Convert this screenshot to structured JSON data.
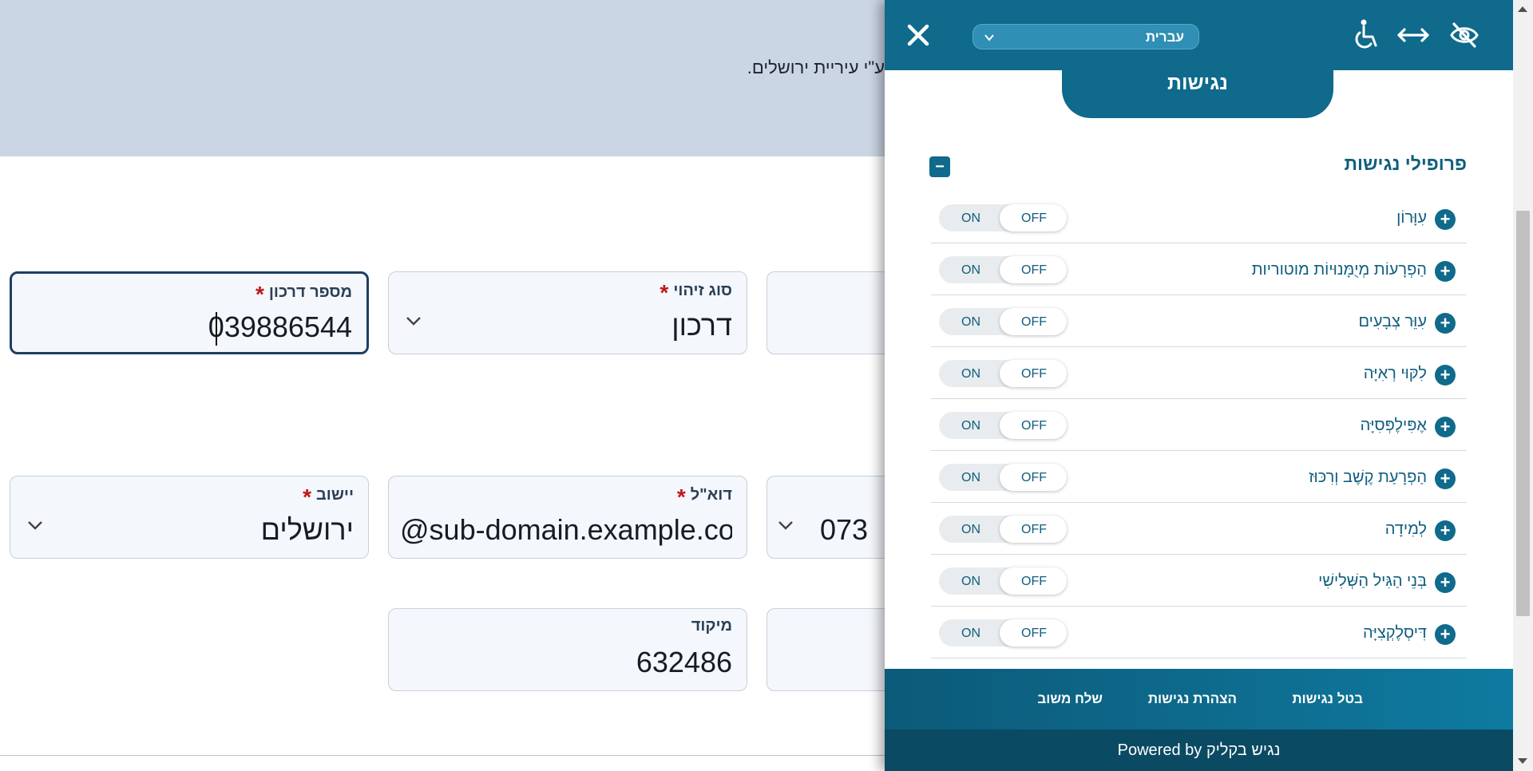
{
  "page": {
    "banner_text": "ע\"י עיריית ירושלים.",
    "fields": {
      "license_number": {
        "label": "מספר דרכון",
        "value": "039886544"
      },
      "id_type": {
        "label": "סוג זיהוי",
        "value": "דרכון"
      },
      "settlement": {
        "label": "יישוב",
        "value": "ירושלים"
      },
      "email": {
        "label": "דוא\"ל",
        "value": "@sub-domain.example.com"
      },
      "phone_prefix": {
        "value": "073"
      },
      "zip": {
        "label": "מיקוד",
        "value": "632486"
      }
    }
  },
  "accessibility": {
    "language": "עברית",
    "tab_title": "נגישות",
    "section_title": "פרופילי נגישות",
    "collapse_symbol": "−",
    "toggle_on": "ON",
    "toggle_off": "OFF",
    "profiles": [
      {
        "label": "עִוָּרוֹן",
        "state": "OFF"
      },
      {
        "label": "הַפְרָעוֹת מְיֻמָּנוּיוֹת מוטוריות",
        "state": "OFF"
      },
      {
        "label": "עִוֵּר צְבָעִים",
        "state": "OFF"
      },
      {
        "label": "לִקּוּי רְאִיָּה",
        "state": "OFF"
      },
      {
        "label": "אֶפִּילֶפְּסִיָּה",
        "state": "OFF"
      },
      {
        "label": "הַפְרָעַת קֶשֶׁב וְרִכּוּז",
        "state": "OFF"
      },
      {
        "label": "לְמִידָה",
        "state": "OFF"
      },
      {
        "label": "בְּנֵי הַגִּיל הַשְּׁלִישִׁי",
        "state": "OFF"
      },
      {
        "label": "דִּיסְלֶקְצִיָּה",
        "state": "OFF"
      }
    ],
    "footer": {
      "cancel": "בטל נגישות",
      "statement": "הצהרת נגישות",
      "feedback": "שלח משוב"
    },
    "powered_by": "Powered by נגיש בקליק",
    "icons": [
      "close-icon",
      "chevron-down-icon",
      "accessibility-wheelchair-icon",
      "horizontal-arrows-icon",
      "eye-off-icon",
      "plus-icon"
    ],
    "colors": {
      "accent": "#0f6a8c",
      "banner": "#cad6e4",
      "required": "#c0171f"
    }
  }
}
